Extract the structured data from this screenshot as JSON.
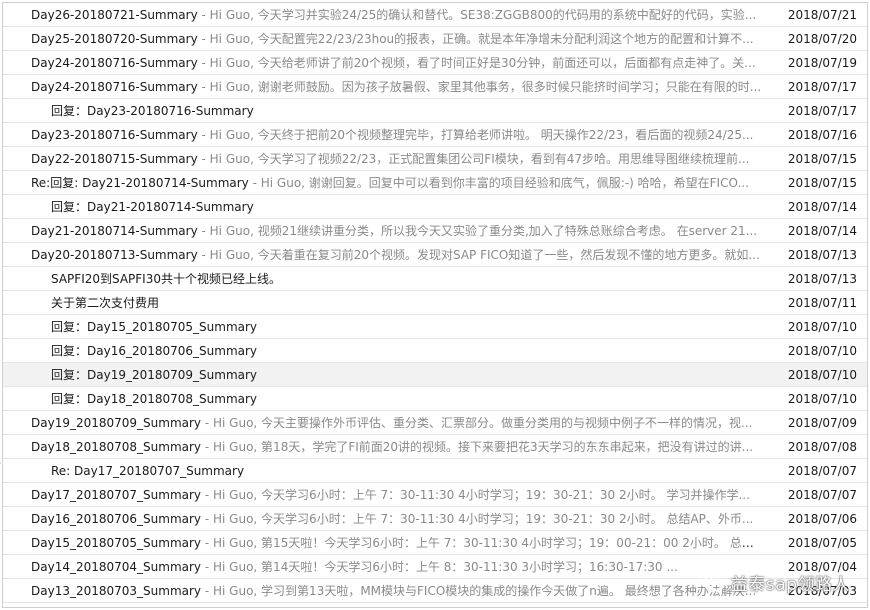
{
  "rows": [
    {
      "title": "Day26-20180721-Summary",
      "snippet": " - Hi Guo, 今天学习并实验24/25的确认和替代。SE38:ZGGB800的代码用的系统中配好的代码，实验...",
      "date": "2018/07/21",
      "indent": false,
      "highlight": false
    },
    {
      "title": "Day25-20180720-Summary",
      "snippet": " - Hi Guo, 今天配置完22/23/23hou的报表，正确。就是本年净增未分配利润这个地方的配置和计算不...",
      "date": "2018/07/20",
      "indent": false,
      "highlight": false
    },
    {
      "title": "Day24-20180716-Summary",
      "snippet": " - Hi Guo, 今天给老师讲了前20个视频，看了时间正好是30分钟，前面还可以，后面都有点走神了。关...",
      "date": "2018/07/19",
      "indent": false,
      "highlight": false
    },
    {
      "title": "Day24-20180716-Summary",
      "snippet": " - Hi Guo, 谢谢老师鼓励。因为孩子放暑假、家里其他事务，很多时候只能挤时间学习；只能在有限的时...",
      "date": "2018/07/17",
      "indent": false,
      "highlight": false
    },
    {
      "title": "回复：Day23-20180716-Summary",
      "snippet": "",
      "date": "2018/07/17",
      "indent": true,
      "highlight": false
    },
    {
      "title": "Day23-20180716-Summary",
      "snippet": " - Hi Guo, 今天终于把前20个视频整理完毕，打算给老师讲啦。 明天操作22/23，看后面的视频24/25...",
      "date": "2018/07/16",
      "indent": false,
      "highlight": false
    },
    {
      "title": "Day22-20180715-Summary",
      "snippet": " - Hi Guo, 今天学习了视频22/23，正式配置集团公司FI模块，看到有47步哈。用思维导图继续梳理前...",
      "date": "2018/07/15",
      "indent": false,
      "highlight": false
    },
    {
      "title": "Re:回复: Day21-20180714-Summary",
      "snippet": " - Hi Guo, 谢谢回复。回复中可以看到你丰富的项目经验和底气，佩服:-) 哈哈，希望在FICO...",
      "date": "2018/07/15",
      "indent": false,
      "highlight": false
    },
    {
      "title": "回复：Day21-20180714-Summary",
      "snippet": "",
      "date": "2018/07/14",
      "indent": true,
      "highlight": false
    },
    {
      "title": "Day21-20180714-Summary",
      "snippet": " - Hi Guo, 视频21继续讲重分类，所以我今天又实验了重分类,加入了特殊总账综合考虑。 在server 21...",
      "date": "2018/07/14",
      "indent": false,
      "highlight": false
    },
    {
      "title": "Day20-20180713-Summary",
      "snippet": " - Hi Guo, 今天着重在复习前20个视频。发现对SAP FICO知道了一些，然后发现不懂的地方更多。就如...",
      "date": "2018/07/13",
      "indent": false,
      "highlight": false
    },
    {
      "title": "SAPFI20到SAPFI30共十个视频已经上线。",
      "snippet": "",
      "date": "2018/07/13",
      "indent": true,
      "highlight": false
    },
    {
      "title": "关于第二次支付费用",
      "snippet": "",
      "date": "2018/07/11",
      "indent": true,
      "highlight": false
    },
    {
      "title": "回复：Day15_20180705_Summary",
      "snippet": "",
      "date": "2018/07/10",
      "indent": true,
      "highlight": false
    },
    {
      "title": "回复：Day16_20180706_Summary",
      "snippet": "",
      "date": "2018/07/10",
      "indent": true,
      "highlight": false
    },
    {
      "title": "回复：Day19_20180709_Summary",
      "snippet": "",
      "date": "2018/07/10",
      "indent": true,
      "highlight": true
    },
    {
      "title": "回复：Day18_20180708_Summary",
      "snippet": "",
      "date": "2018/07/10",
      "indent": true,
      "highlight": false
    },
    {
      "title": "Day19_20180709_Summary",
      "snippet": " - Hi Guo, 今天主要操作外币评估、重分类、汇票部分。做重分类用的与视频中例子不一样的情况，视...",
      "date": "2018/07/09",
      "indent": false,
      "highlight": false
    },
    {
      "title": "Day18_20180708_Summary",
      "snippet": " - Hi Guo, 第18天，学完了FI前面20讲的视频。接下来要把花3天学习的东东串起来，把没有讲过的讲...",
      "date": "2018/07/08",
      "indent": false,
      "highlight": false
    },
    {
      "title": "Re: Day17_20180707_Summary",
      "snippet": "",
      "date": "2018/07/07",
      "indent": true,
      "highlight": false
    },
    {
      "title": "Day17_20180707_Summary",
      "snippet": " - Hi Guo, 今天学习6小时：上午 7：30-11:30 4小时学习；19：30-21：30 2小时。 学习并操作学...",
      "date": "2018/07/07",
      "indent": false,
      "highlight": false
    },
    {
      "title": "Day16_20180706_Summary",
      "snippet": " - Hi Guo, 今天学习6小时：上午 7：30-11:30 4小时学习；19：30-21：30 2小时。 总结AP、外币...",
      "date": "2018/07/06",
      "indent": false,
      "highlight": false
    },
    {
      "title": "Day15_20180705_Summary",
      "snippet": " - Hi Guo, 第15天啦！今天学习6小时：上午 7：30-11:30 4小时学习；19：00-21：00 2小时。 总结...",
      "date": "2018/07/05",
      "indent": false,
      "highlight": false
    },
    {
      "title": "Day14_20180704_Summary",
      "snippet": " - Hi Guo, 第14天啦！今天学习6小时：上午 8：30-11:30 3小时学习；16:30-17:30 ...",
      "date": "2018/07/04",
      "indent": false,
      "highlight": false
    },
    {
      "title": "Day13_20180703_Summary",
      "snippet": " - Hi Guo, 学习到第13天啦，MM模块与FICO模块的集成的操作今天做了n遍。 最终想了各种办法解决...",
      "date": "2018/07/03",
      "indent": false,
      "highlight": false
    }
  ],
  "watermark": {
    "text": "益泰sap领路人",
    "icon": "wechat-icon"
  }
}
